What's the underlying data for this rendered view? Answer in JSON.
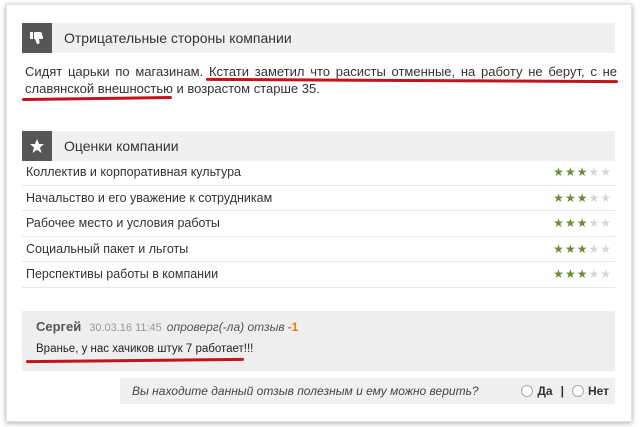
{
  "negative": {
    "header": "Отрицательные стороны компании",
    "text": "Сидят царьки по магазинам. Кстати заметил что расисты отменные, на работу не берут, с не славянской внешностью и возрастом старше 35."
  },
  "ratings": {
    "header": "Оценки компании",
    "items": [
      {
        "label": "Коллектив и корпоративная культура",
        "stars": 3
      },
      {
        "label": "Начальство и его уважение к сотрудникам",
        "stars": 3
      },
      {
        "label": "Рабочее место и условия работы",
        "stars": 3
      },
      {
        "label": "Социальный пакет и льготы",
        "stars": 3
      },
      {
        "label": "Перспективы работы в компании",
        "stars": 3
      }
    ]
  },
  "review": {
    "author": "Сергей",
    "date": "30.03.16 11:45",
    "action": "опроверг(-ла) отзыв",
    "score": "-1",
    "text": "Вранье, у нас хачиков штук 7 работает!!!"
  },
  "useful": {
    "question": "Вы находите данный отзыв полезным и ему можно верить?",
    "yes": "Да",
    "separator": "|",
    "no": "Нет"
  },
  "colors": {
    "annotation": "#c4131c",
    "star_on": "#6e8a3a",
    "badge": "#565656"
  },
  "icons": {
    "negative": "thumbs-down-icon",
    "ratings": "star-icon"
  }
}
